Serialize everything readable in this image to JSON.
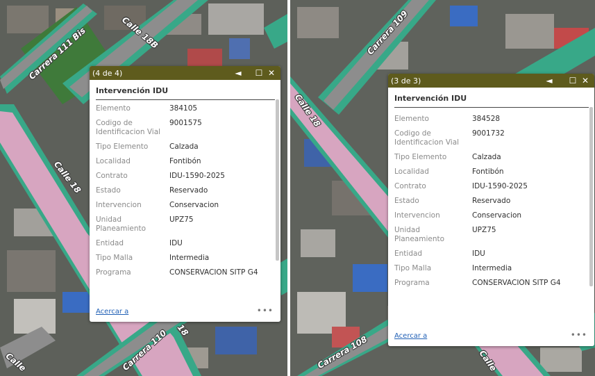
{
  "map_left": {
    "road_labels": [
      "Carrera 111 Bis",
      "Calle 18B",
      "Calle 18",
      "Carrera 110",
      "18",
      "Calle"
    ],
    "popup": {
      "pager": "(4 de 4)",
      "section_title": "Intervención IDU",
      "fields": [
        {
          "key": "Elemento",
          "value": "384105"
        },
        {
          "key": "Codigo de Identificacion Vial",
          "value": "9001575"
        },
        {
          "key": "Tipo Elemento",
          "value": "Calzada"
        },
        {
          "key": "Localidad",
          "value": "Fontibón"
        },
        {
          "key": "Contrato",
          "value": "IDU-1590-2025"
        },
        {
          "key": "Estado",
          "value": "Reservado"
        },
        {
          "key": "Intervencion",
          "value": "Conservacion"
        },
        {
          "key": "Unidad Planeamiento",
          "value": "UPZ75"
        },
        {
          "key": "Entidad",
          "value": "IDU"
        },
        {
          "key": "Tipo Malla",
          "value": "Intermedia"
        },
        {
          "key": "Programa",
          "value": "CONSERVACION SITP G4"
        }
      ],
      "zoom_link": "Acercar a",
      "more": "•••"
    }
  },
  "map_right": {
    "road_labels": [
      "Carrera 109",
      "Calle 18",
      "Carrera 108",
      "Calle"
    ],
    "popup": {
      "pager": "(3 de 3)",
      "section_title": "Intervención IDU",
      "fields": [
        {
          "key": "Elemento",
          "value": "384528"
        },
        {
          "key": "Codigo de Identificacion Vial",
          "value": "9001732"
        },
        {
          "key": "Tipo Elemento",
          "value": "Calzada"
        },
        {
          "key": "Localidad",
          "value": "Fontibón"
        },
        {
          "key": "Contrato",
          "value": "IDU-1590-2025"
        },
        {
          "key": "Estado",
          "value": "Reservado"
        },
        {
          "key": "Intervencion",
          "value": "Conservacion"
        },
        {
          "key": "Unidad Planeamiento",
          "value": "UPZ75"
        },
        {
          "key": "Entidad",
          "value": "IDU"
        },
        {
          "key": "Tipo Malla",
          "value": "Intermedia"
        },
        {
          "key": "Programa",
          "value": "CONSERVACION SITP G4"
        }
      ],
      "zoom_link": "Acercar a",
      "more": "•••"
    }
  },
  "icons": {
    "prev": "◄",
    "maximize": "☐",
    "close": "✕"
  },
  "colors": {
    "popup_header": "#5e5b1d",
    "road_highlight": "#3aa888",
    "road_fill": "#e2a6c6",
    "link": "#1f5fb5"
  }
}
